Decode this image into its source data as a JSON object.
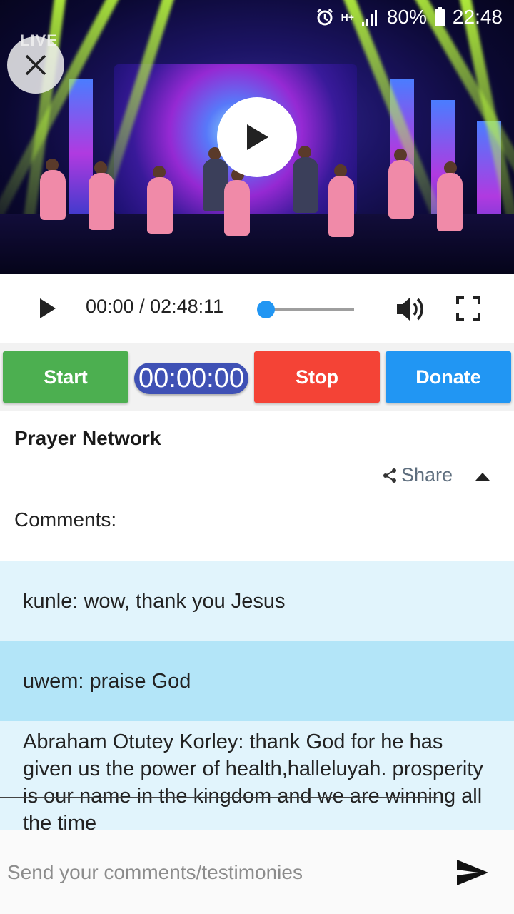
{
  "status_bar": {
    "battery": "80%",
    "time": "22:48",
    "network": "H+"
  },
  "video": {
    "live_label": "LIVE"
  },
  "player": {
    "time_display": "00:00 / 02:48:11",
    "progress": 0
  },
  "actions": {
    "start_label": "Start",
    "timer": "00:00:00",
    "stop_label": "Stop",
    "donate_label": "Donate"
  },
  "info": {
    "title": "Prayer Network",
    "share_label": "Share",
    "comments_label": "Comments:"
  },
  "comments": [
    {
      "text": "kunle: wow, thank you Jesus"
    },
    {
      "text": "uwem: praise God"
    },
    {
      "text": "Abraham Otutey Korley: thank God for he has given us the power of health,halleluyah. prosperity is our name in the kingdom and we are winning all the time"
    }
  ],
  "input": {
    "placeholder": "Send your comments/testimonies"
  },
  "colors": {
    "start": "#4caf50",
    "stop": "#f44336",
    "donate": "#2196f3",
    "timer": "#3f51b5",
    "accent": "#2196f3"
  },
  "icons": [
    "close-icon",
    "play-icon",
    "volume-icon",
    "fullscreen-icon",
    "share-icon",
    "chevron-up-icon",
    "send-icon",
    "alarm-icon",
    "signal-icon",
    "battery-icon"
  ]
}
